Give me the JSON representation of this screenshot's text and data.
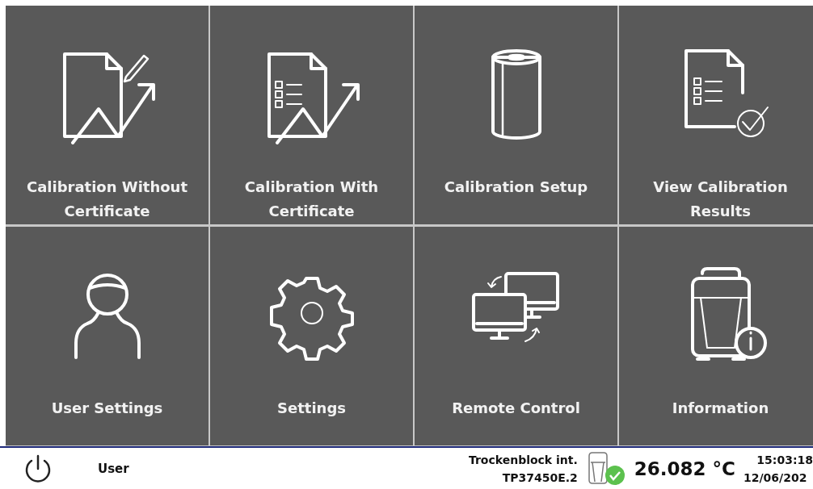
{
  "tiles": [
    {
      "label": "Calibration Without Certificate"
    },
    {
      "label": "Calibration With Certificate"
    },
    {
      "label": "Calibration Setup"
    },
    {
      "label": "View Calibration Results"
    },
    {
      "label": "User Settings"
    },
    {
      "label": "Settings"
    },
    {
      "label": "Remote Control"
    },
    {
      "label": "Information"
    }
  ],
  "status_bar": {
    "user": "User",
    "device_name": "Trockenblock int.",
    "device_serial": "TP37450E.2",
    "device_connected": true,
    "temperature": "26.082 °C",
    "time": "15:03:18",
    "date": "12/06/202"
  }
}
